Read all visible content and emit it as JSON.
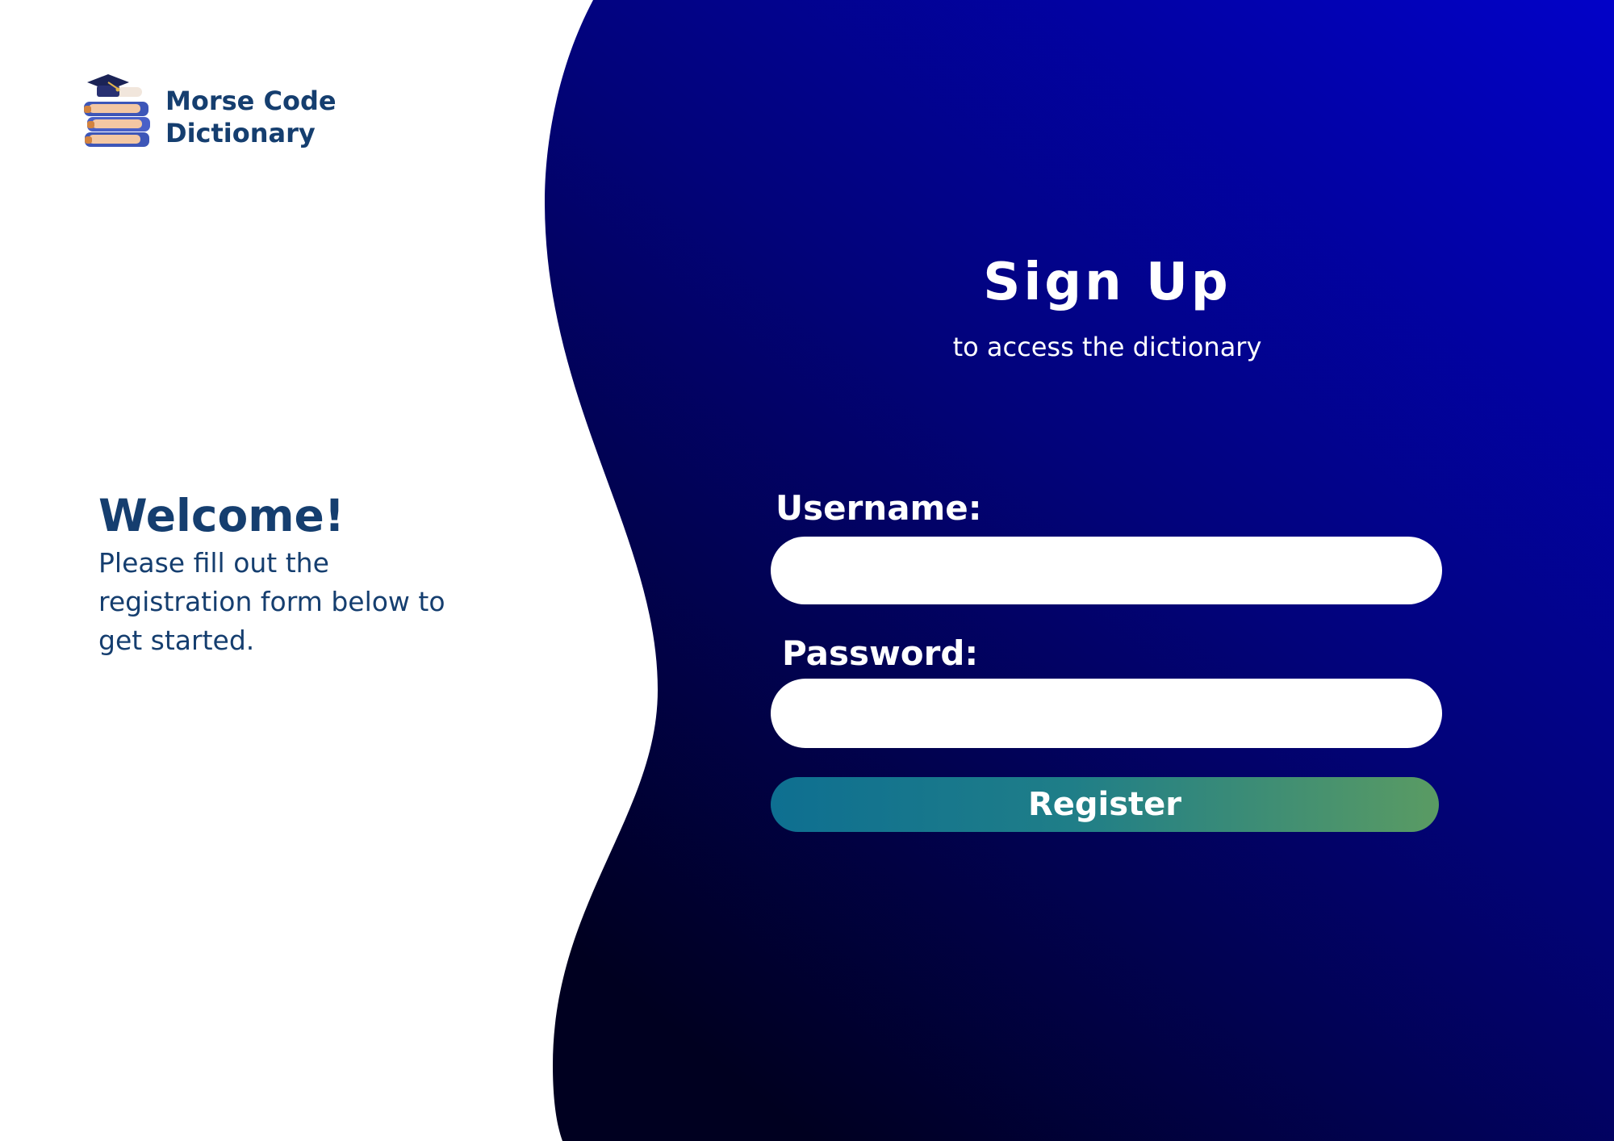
{
  "brand": {
    "name_line1": "Morse Code",
    "name_line2": "Dictionary",
    "logo_icon": "books-with-graduation-cap-icon"
  },
  "welcome": {
    "title": "Welcome!",
    "text": "Please fill out the registration form below to get started."
  },
  "form": {
    "title": "Sign Up",
    "subtitle": "to access the dictionary",
    "username_label": "Username:",
    "username_value": "",
    "password_label": "Password:",
    "password_value": "",
    "register_label": "Register"
  },
  "colors": {
    "brand_text": "#153e6f",
    "panel_gradient_dark": "#000020",
    "panel_gradient_mid": "#02037a",
    "panel_gradient_light": "#0202c8",
    "button_gradient_start": "#0e6f91",
    "button_gradient_end": "#5a9b63",
    "field_background": "#ffffff"
  }
}
